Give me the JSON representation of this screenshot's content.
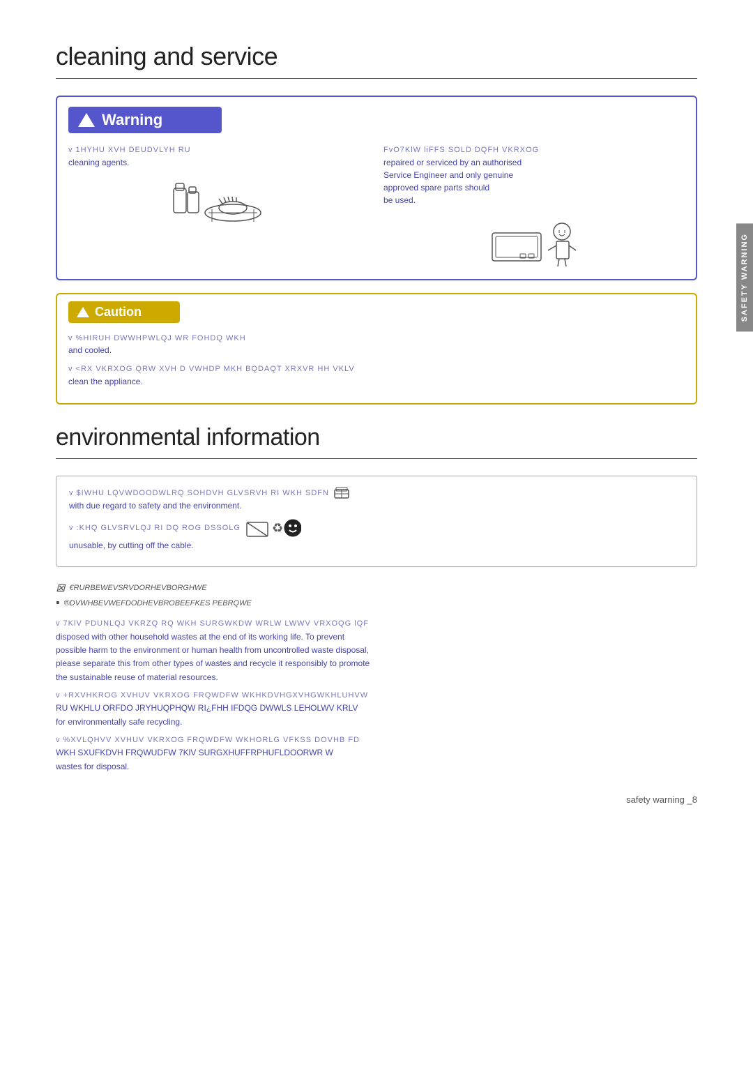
{
  "page": {
    "section1_title": "cleaning and service",
    "section2_title": "environmental information",
    "footer": "safety warning _8"
  },
  "warning": {
    "header_label": "Warning",
    "col1": {
      "encoded_line": "v 1HYHU XVH DEUDVLYH RU",
      "plain_line": "cleaning agents."
    },
    "col2": {
      "encoded_line": "FvO7KlW liFFS SOLD DQFH VKRXOG",
      "lines": [
        "repaired or serviced by an authorised",
        "Service Engineer and only genuine",
        "approved spare parts should",
        "be used."
      ]
    }
  },
  "caution": {
    "header_label": "Caution",
    "lines": [
      {
        "encoded": "v %HIRUH DWWHPWLQJ WR FOHDQ WKH",
        "plain": "and cooled."
      },
      {
        "encoded": "v <RX VKRXOG QRW XVH D VWHDP MKH BQDAQT XRXVR HH VKLV",
        "plain": "clean the appliance."
      }
    ]
  },
  "environmental": {
    "box_lines": [
      {
        "encoded": "v $IWHU LQVWDOODWLRQ  SOHDVH GLVSRVH RI WKH SDFN",
        "plain": "with due regard to safety and the environment."
      },
      {
        "encoded": "v :KHQ GLVSRVLQJ RI DQ ROG DSSOLG",
        "plain": "unusable, by cutting off the cable."
      }
    ],
    "recycling_lines": [
      "€RURBEWEVSRVDORHEVBORGHWE",
      "®DVWHBEVWEFDODHEVBROBEEFKES PEBRQWE"
    ],
    "body_lines": [
      {
        "encoded": "v 7KlV PDUNLQJ VKRZQ RQ WKH SURGWKDW WRLW LWWV VRXOQG lQF",
        "plain1": "disposed with other household wastes at the end of its working life. To prevent",
        "plain2": "possible harm to the environment or human health from uncontrolled waste disposal,",
        "plain3": "please separate this from other types of wastes and recycle it responsibly to promote",
        "plain4": "the sustainable reuse of material resources."
      },
      {
        "encoded": "v +RXVHKROG XVHUV VKRXOG FRQWDFW WKHKDVHGXVHGWKHLUHVW",
        "plain1": "RU WKHLU ORFDO JRYHUQPHQW RI¿FHH IFDQG DWWLS LEHOLWV KRLV",
        "plain2": "for environmentally safe recycling."
      },
      {
        "encoded": "v %XVLQHVV XVHUV VKRXOG FRQWDFW WKHORLG VFKSS DOVHB FD",
        "plain1": "WKH SXUFKDVH FRQWUDFW  7KlV SURGXHUFFRPHUFLDOORWR W",
        "plain2": "wastes for disposal."
      }
    ]
  },
  "side_tab": {
    "label": "SAFETY WARNING"
  }
}
